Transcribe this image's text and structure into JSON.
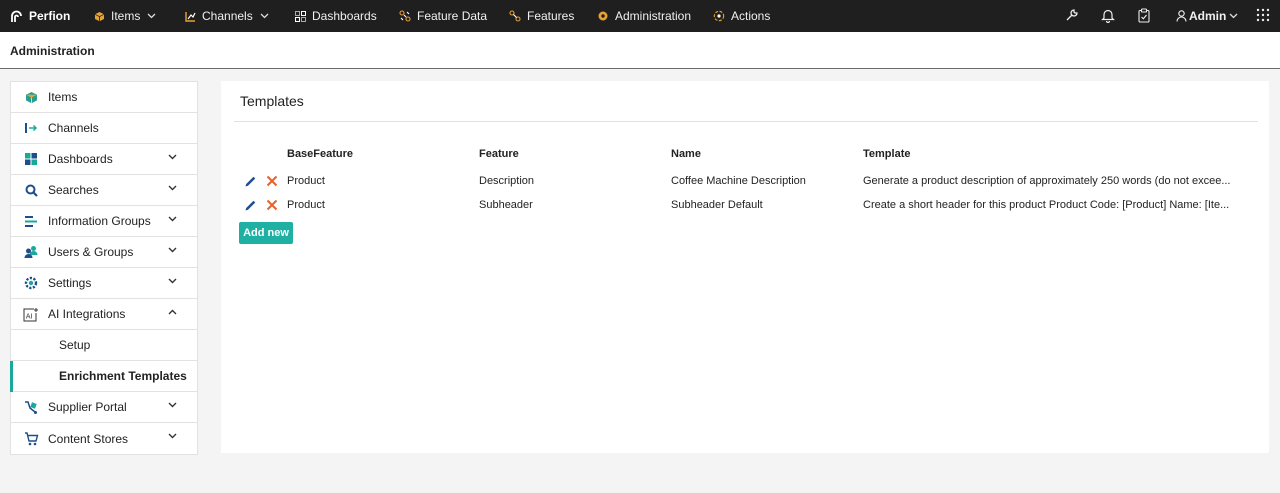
{
  "topnav": {
    "brand": "Perfion",
    "items": [
      {
        "label": "Items"
      },
      {
        "label": "Channels"
      },
      {
        "label": "Dashboards"
      },
      {
        "label": "Feature Data"
      },
      {
        "label": "Features"
      },
      {
        "label": "Administration"
      },
      {
        "label": "Actions"
      }
    ],
    "user": "Admin"
  },
  "page": {
    "title": "Administration"
  },
  "sidebar": {
    "items": [
      {
        "label": "Items",
        "icon": "box-icon"
      },
      {
        "label": "Channels",
        "icon": "channels-icon"
      },
      {
        "label": "Dashboards",
        "icon": "dashboard-icon",
        "expandable": true
      },
      {
        "label": "Searches",
        "icon": "search-icon",
        "expandable": true
      },
      {
        "label": "Information Groups",
        "icon": "list-icon",
        "expandable": true
      },
      {
        "label": "Users & Groups",
        "icon": "users-icon",
        "expandable": true
      },
      {
        "label": "Settings",
        "icon": "gear-icon",
        "expandable": true
      },
      {
        "label": "AI Integrations",
        "icon": "ai-icon",
        "expanded": true
      },
      {
        "label": "Supplier Portal",
        "icon": "supplier-icon",
        "expandable": true
      },
      {
        "label": "Content Stores",
        "icon": "cart-icon",
        "expandable": true
      }
    ],
    "subitems": [
      {
        "label": "Setup"
      },
      {
        "label": "Enrichment Templates",
        "active": true
      }
    ]
  },
  "main": {
    "title": "Templates",
    "columns": [
      "BaseFeature",
      "Feature",
      "Name",
      "Template"
    ],
    "rows": [
      [
        "Product",
        "Description",
        "Coffee Machine Description",
        "Generate a product description of approximately 250 words (do not excee..."
      ],
      [
        "Product",
        "Subheader",
        "Subheader Default",
        "Create a short header for this product Product Code: [Product] Name: [Ite..."
      ]
    ],
    "add_label": "Add new"
  },
  "colors": {
    "accent": "#1eb1a3",
    "nav_bg": "#1f1f1f",
    "edit": "#1f4e8c",
    "delete": "#e5622b"
  }
}
